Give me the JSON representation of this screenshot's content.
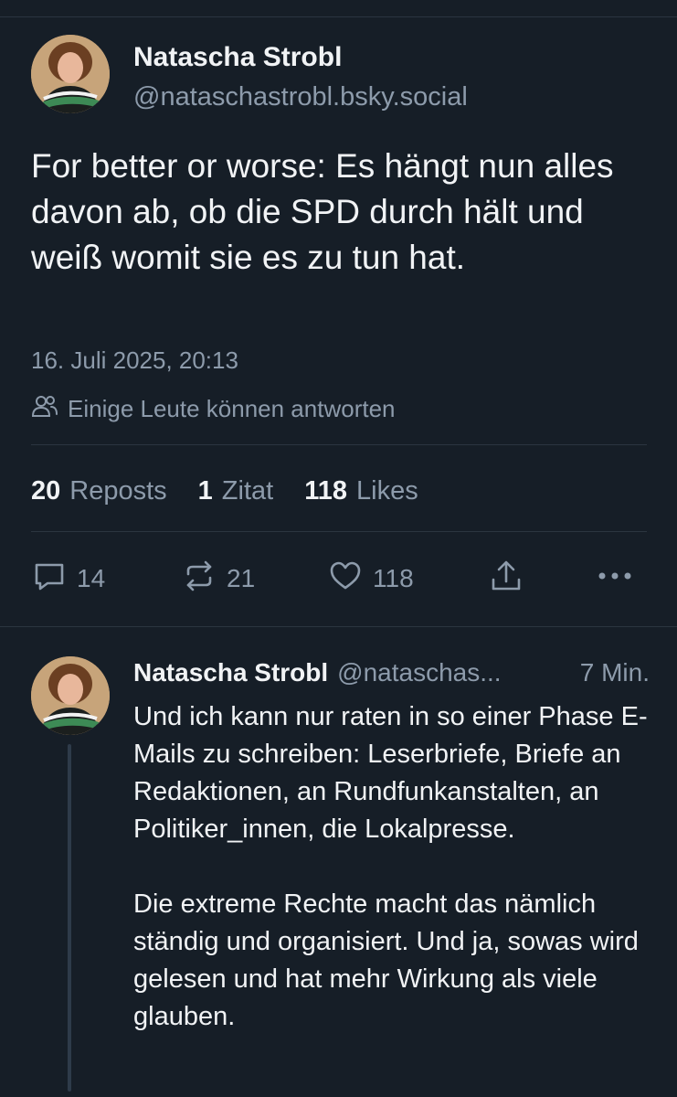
{
  "post": {
    "author_name": "Natascha Strobl",
    "author_handle": "@nataschastrobl.bsky.social",
    "text": "For better or worse: Es hängt nun alles davon ab, ob die SPD durch hält und weiß womit sie es zu tun hat.",
    "timestamp": "16. Juli 2025, 20:13",
    "reply_setting": "Einige Leute können antworten",
    "stats": {
      "reposts_count": "20",
      "reposts_label": "Reposts",
      "quotes_count": "1",
      "quotes_label": "Zitat",
      "likes_count": "118",
      "likes_label": "Likes"
    },
    "actions": {
      "reply_count": "14",
      "repost_count": "21",
      "like_count": "118"
    }
  },
  "reply": {
    "author_name": "Natascha Strobl",
    "author_handle": "@nataschas...",
    "time": "7 Min.",
    "paragraph1": "Und ich kann nur raten in so einer Phase E-Mails zu schreiben: Leserbriefe, Briefe an Redaktionen, an Rundfunkanstalten, an Politiker_innen, die Lokalpresse.",
    "paragraph2": "Die extreme Rechte macht das nämlich ständig und organisiert. Und ja, sowas wird gelesen und hat mehr Wirkung als viele glauben."
  },
  "icons": [
    "people-icon",
    "reply-icon",
    "repost-icon",
    "like-icon",
    "share-icon",
    "more-icon"
  ],
  "colors": {
    "background": "#161e27",
    "text": "#f1f3f5",
    "muted": "#8d9bab",
    "divider": "#2b3540"
  }
}
